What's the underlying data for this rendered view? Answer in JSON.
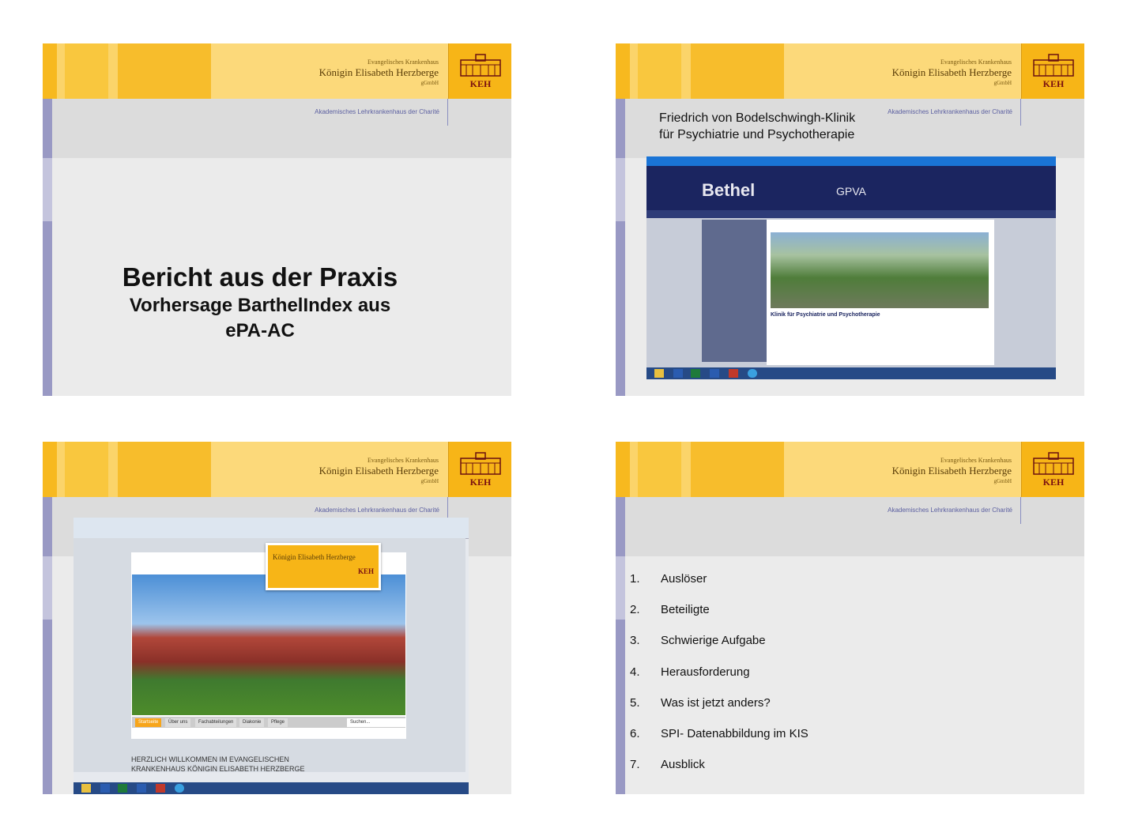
{
  "header": {
    "org_small": "Evangelisches Krankenhaus",
    "org_name": "Königin Elisabeth Herzberge",
    "org_gmbh": "gGmbH",
    "logo_text": "KEH",
    "academic": "Akademisches Lehrkrankenhaus der Charité"
  },
  "slide1": {
    "title": "Bericht aus der Praxis",
    "subtitle_line1": "Vorhersage BarthelIndex  aus",
    "subtitle_line2": "ePA-AC"
  },
  "slide2": {
    "title_line1": "Friedrich von Bodelschwingh-Klinik",
    "title_line2": "für Psychiatrie und Psychotherapie",
    "brand": "Bethel",
    "gpva": "GPVA",
    "page_heading": "Klinik für Psychiatrie und Psychotherapie"
  },
  "slide3": {
    "tabs": [
      "Startseite",
      "Über uns",
      "Fachabteilungen",
      "Diakonie",
      "Pflege"
    ],
    "search_placeholder": "Suchen...",
    "welcome_line1": "HERZLICH WILLKOMMEN IM EVANGELISCHEN",
    "welcome_line2": "KRANKENHAUS KÖNIGIN ELISABETH HERZBERGE"
  },
  "slide4": {
    "items": [
      {
        "num": "1.",
        "text": "Auslöser"
      },
      {
        "num": "2.",
        "text": "Beteiligte"
      },
      {
        "num": "3.",
        "text": "Schwierige Aufgabe"
      },
      {
        "num": "4.",
        "text": "Herausforderung"
      },
      {
        "num": "5.",
        "text": "Was ist jetzt anders?"
      },
      {
        "num": "6.",
        "text": "SPI- Datenabbildung im KIS"
      },
      {
        "num": "7.",
        "text": "Ausblick"
      }
    ]
  },
  "colors": {
    "header_yellow": "#fbd46a",
    "logo_orange": "#f7b517",
    "accent_purple": "#9999c4",
    "bethel_navy": "#1b2560"
  }
}
